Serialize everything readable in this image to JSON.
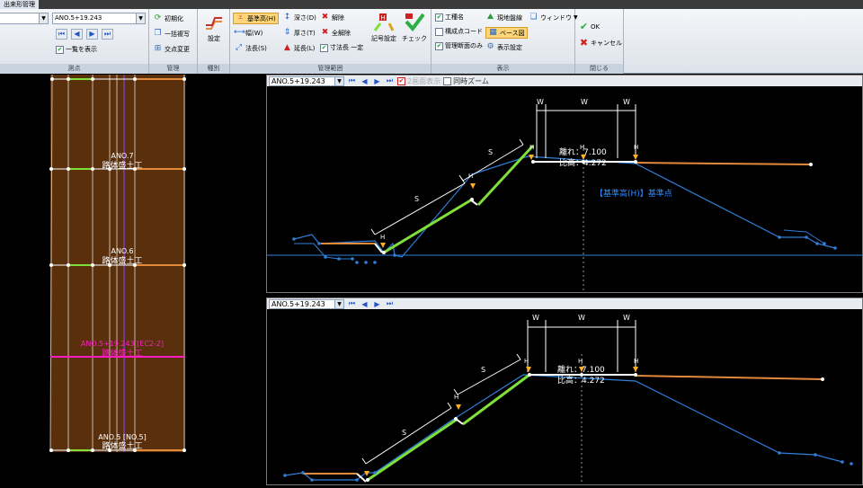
{
  "title_tab": "出来形管理",
  "ribbon": {
    "groups": {
      "survey": {
        "caption": "測点"
      },
      "manage": {
        "caption": "管理"
      },
      "kind": {
        "caption": "種別"
      },
      "manage_range": {
        "caption": "管理範囲"
      },
      "display": {
        "caption": "表示"
      },
      "close": {
        "caption": "閉じる"
      }
    },
    "station_combo": "ANO.5+19.243",
    "list_display": "一覧を表示",
    "init": "初期化",
    "batch_copy": "一括複写",
    "intersection_change": "交点変更",
    "settings": "設定",
    "base_height": "基準高(H)",
    "width": "幅(W)",
    "slope_length": "法長(S)",
    "depth": "深さ(D)",
    "thickness": "厚さ(T)",
    "extension": "延長(L)",
    "release": "解除",
    "release_all": "全解除",
    "dim_const": "寸法長 一定",
    "symbol_settings": "記号設定",
    "check": "チェック",
    "construction_name": "工種名",
    "structure_code": "構成点コード",
    "manage_section_only": "管理断面のみ",
    "current_ground": "現地盤線",
    "base_diagram": "ベース図",
    "display_settings": "表示設定",
    "window": "ウィンドウ",
    "ok": "OK",
    "cancel": "キャンセル"
  },
  "left_pane": {
    "labels": [
      {
        "station": "ANO.7",
        "type": "路体盛土工"
      },
      {
        "station": "ANO.6",
        "type": "路体盛土工"
      },
      {
        "station": "ANO.5+19.243 [EC2-2]",
        "type": "路体盛土工"
      },
      {
        "station": "ANO.5 [NO.5]",
        "type": "路体盛土工"
      }
    ]
  },
  "view_top": {
    "station": "ANO.5+19.243",
    "two_view": "2画面表示",
    "sync_zoom": "同時ズーム",
    "dim_w": "W",
    "dim_s": "S",
    "dim_h": "H",
    "offset_text": "離れ：7.100",
    "height_text": "比高：4.272",
    "annotation": "【基準高(H)】基準点"
  },
  "view_bottom": {
    "station": "ANO.5+19.243",
    "dim_w": "W",
    "dim_s": "S",
    "dim_h": "H",
    "offset_text": "離れ：7.100",
    "height_text": "比高：4.272"
  },
  "colors": {
    "accent_green": "#7fe03a",
    "orange_line": "#e08a3a",
    "blue_line": "#2f7fd8",
    "magenta": "#ff1cc4",
    "fill_brown": "#5a300c",
    "annotation_blue": "#2f8cff"
  }
}
